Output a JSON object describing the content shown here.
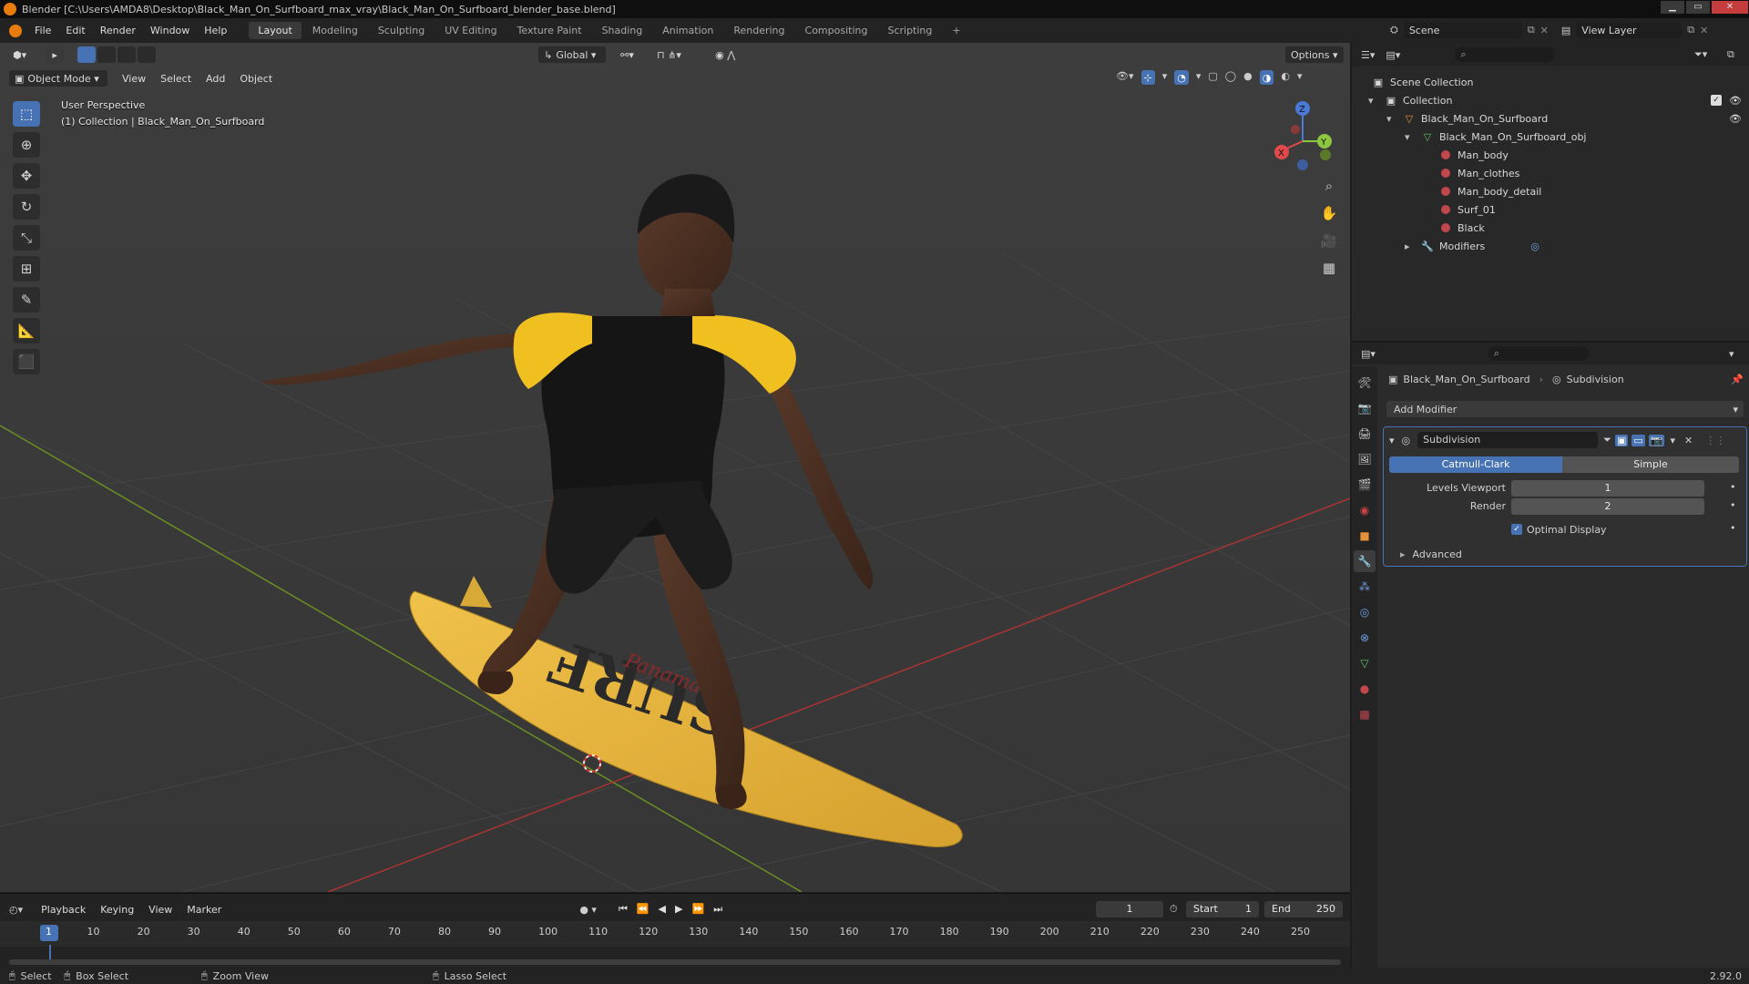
{
  "titlebar": {
    "title": "Blender [C:\\Users\\AMDA8\\Desktop\\Black_Man_On_Surfboard_max_vray\\Black_Man_On_Surfboard_blender_base.blend]"
  },
  "menu": {
    "items": [
      "File",
      "Edit",
      "Render",
      "Window",
      "Help"
    ]
  },
  "workspaces": {
    "tabs": [
      "Layout",
      "Modeling",
      "Sculpting",
      "UV Editing",
      "Texture Paint",
      "Shading",
      "Animation",
      "Rendering",
      "Compositing",
      "Scripting"
    ],
    "active": "Layout",
    "add": "+"
  },
  "scene": {
    "label": "Scene",
    "view_layer": "View Layer"
  },
  "viewport": {
    "orientation": "Global",
    "options": "Options",
    "mode": "Object Mode",
    "menus": [
      "View",
      "Select",
      "Add",
      "Object"
    ],
    "overlay_title": "User Perspective",
    "overlay_sub": "(1) Collection | Black_Man_On_Surfboard",
    "board_text": "SURF",
    "board_brand": "Panama"
  },
  "gizmo": {
    "x": "X",
    "y": "Y",
    "z": "Z"
  },
  "outliner": {
    "scene_collection": "Scene Collection",
    "collection": "Collection",
    "object": "Black_Man_On_Surfboard",
    "mesh": "Black_Man_On_Surfboard_obj",
    "materials": [
      "Man_body",
      "Man_clothes",
      "Man_body_detail",
      "Surf_01",
      "Black"
    ],
    "modifiers": "Modifiers"
  },
  "properties": {
    "breadcrumb_object": "Black_Man_On_Surfboard",
    "breadcrumb_modifier": "Subdivision",
    "add_modifier": "Add Modifier",
    "modifier_name": "Subdivision",
    "catmull": "Catmull-Clark",
    "simple": "Simple",
    "levels_viewport_label": "Levels Viewport",
    "levels_viewport": "1",
    "render_label": "Render",
    "render": "2",
    "optimal_display": "Optimal Display",
    "advanced": "Advanced"
  },
  "timeline": {
    "menus": [
      "Playback",
      "Keying",
      "View",
      "Marker"
    ],
    "current_frame": "1",
    "start_label": "Start",
    "start": "1",
    "end_label": "End",
    "end": "250",
    "ticks": [
      "1",
      "10",
      "20",
      "30",
      "40",
      "50",
      "60",
      "70",
      "80",
      "90",
      "100",
      "110",
      "120",
      "130",
      "140",
      "150",
      "160",
      "170",
      "180",
      "190",
      "200",
      "210",
      "220",
      "230",
      "240",
      "250"
    ]
  },
  "status": {
    "select": "Select",
    "box_select": "Box Select",
    "zoom_view": "Zoom View",
    "lasso_select": "Lasso Select",
    "version": "2.92.0"
  },
  "colors": {
    "accent": "#4772b3",
    "header": "#232323",
    "viewport": "#393939",
    "shirt": "#f0c020",
    "board": "#e3b43a"
  }
}
